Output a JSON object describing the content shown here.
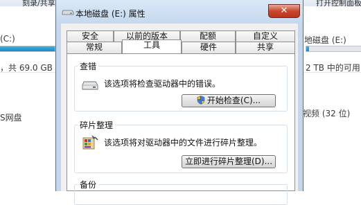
{
  "background": {
    "topbar_left": "刻录/共享网络驱动器",
    "topbar_right": "打开控制面板",
    "left_drive_label": "(C:)",
    "left_drive_space": "，共 69.0 GB",
    "left_item": "S网盘",
    "left_meter_fill_fraction": 1.0,
    "right_drive_label": "地磁盘 (E:)",
    "right_drive_space": "2 TB 中的可用",
    "right_item": "视频 (32 位)",
    "right_meter_fill_fraction": 0.05
  },
  "dialog": {
    "title": "本地磁盘 (E:) 属性",
    "close_label": "✕",
    "tabs_row1": [
      "安全",
      "以前的版本",
      "配额",
      "自定义"
    ],
    "tabs_row2": [
      "常规",
      "工具",
      "硬件",
      "共享"
    ],
    "active_tab": "工具",
    "sections": {
      "check": {
        "title": "查错",
        "desc": "该选项将检查驱动器中的错误。",
        "button": "开始检查(C)..."
      },
      "defrag": {
        "title": "碎片整理",
        "desc": "该选项将对驱动器中的文件进行碎片整理。",
        "button": "立即进行碎片整理(D)..."
      },
      "backup": {
        "title": "备份"
      }
    }
  },
  "colors": {
    "window_frame": "#c5d7ec",
    "close_button": "#c8472e",
    "meter": "#1e86c4"
  }
}
